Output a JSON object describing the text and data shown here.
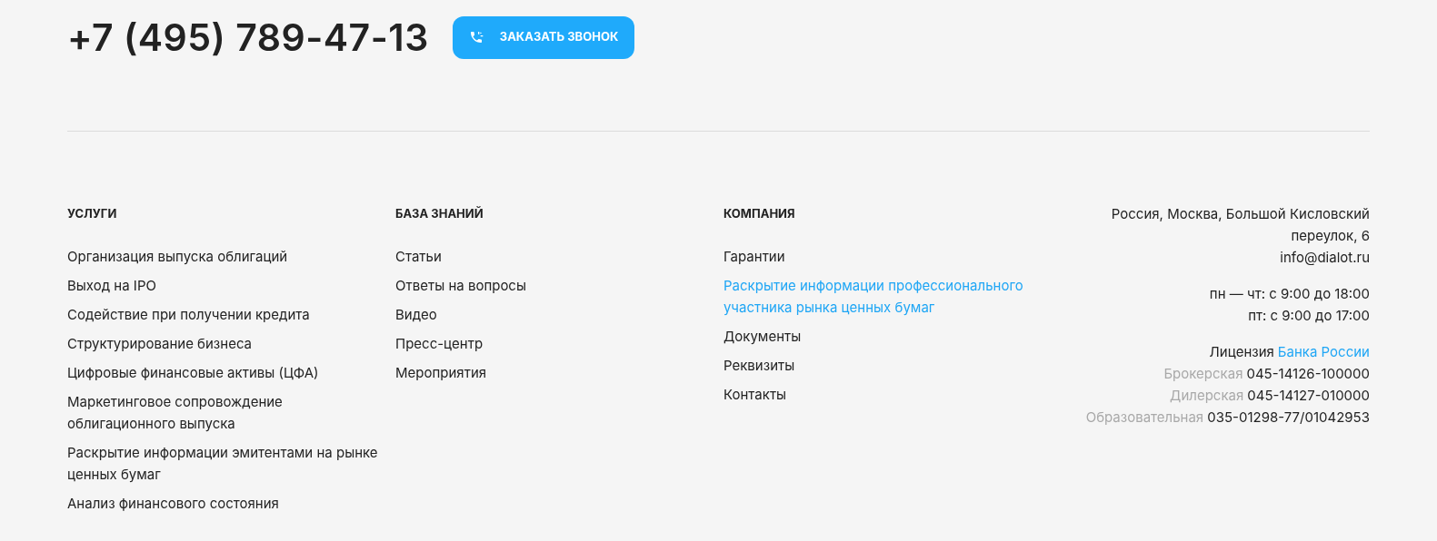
{
  "phone": "+7 (495) 789-47-13",
  "callback_button": "ЗАКАЗАТЬ ЗВОНОК",
  "columns": [
    {
      "heading": "УСЛУГИ",
      "items": [
        {
          "label": "Организация выпуска облигаций",
          "highlighted": false
        },
        {
          "label": "Выход на IPO",
          "highlighted": false
        },
        {
          "label": "Содействие при получении кредита",
          "highlighted": false
        },
        {
          "label": "Структурирование бизнеса",
          "highlighted": false
        },
        {
          "label": "Цифровые финансовые активы (ЦФА)",
          "highlighted": false
        },
        {
          "label": "Маркетинговое сопровождение облигационного выпуска",
          "highlighted": false
        },
        {
          "label": "Раскрытие информации эмитентами на рынке ценных бумаг",
          "highlighted": false
        },
        {
          "label": "Анализ финансового состояния",
          "highlighted": false
        }
      ]
    },
    {
      "heading": "БАЗА ЗНАНИЙ",
      "items": [
        {
          "label": "Статьи",
          "highlighted": false
        },
        {
          "label": "Ответы на вопросы",
          "highlighted": false
        },
        {
          "label": "Видео",
          "highlighted": false
        },
        {
          "label": "Пресс-центр",
          "highlighted": false
        },
        {
          "label": "Мероприятия",
          "highlighted": false
        }
      ]
    },
    {
      "heading": "КОМПАНИЯ",
      "items": [
        {
          "label": "Гарантии",
          "highlighted": false
        },
        {
          "label": "Раскрытие информации профессионального участника рынка ценных бумаг",
          "highlighted": true
        },
        {
          "label": "Документы",
          "highlighted": false
        },
        {
          "label": "Реквизиты",
          "highlighted": false
        },
        {
          "label": "Контакты",
          "highlighted": false
        }
      ]
    }
  ],
  "contacts": {
    "address": [
      "Россия, Москва, Большой Кисловский",
      "переулок, 6"
    ],
    "email": "info@dialot.ru",
    "hours": [
      "пн — чт: с 9:00 до 18:00",
      "пт: с 9:00 до 17:00"
    ]
  },
  "license": {
    "label": "Лицензия",
    "link": "Банка России",
    "entries": [
      {
        "type": "Брокерская",
        "number": "045-14126-100000"
      },
      {
        "type": "Дилерская",
        "number": "045-14127-010000"
      },
      {
        "type": "Образовательная",
        "number": "035-01298-77/01042953"
      }
    ]
  }
}
